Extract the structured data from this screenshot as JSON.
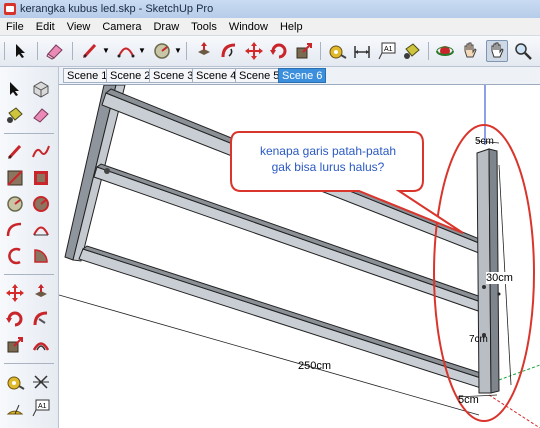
{
  "window": {
    "title": "kerangka kubus led.skp - SketchUp Pro"
  },
  "menu": {
    "items": [
      "File",
      "Edit",
      "View",
      "Camera",
      "Draw",
      "Tools",
      "Window",
      "Help"
    ]
  },
  "toolbar": {
    "icons": [
      "select-arrow-icon",
      "eraser-icon",
      "pencil-line-icon",
      "arc-icon",
      "circle-icon",
      "push-pull-icon",
      "follow-me-icon",
      "move-icon",
      "rotate-icon",
      "scale-icon",
      "tape-measure-icon",
      "text-label-icon",
      "paint-bucket-icon",
      "orbit-icon",
      "pan-hand-icon",
      "zoom-icon"
    ]
  },
  "scenes": {
    "tabs": [
      "Scene 1",
      "Scene 2",
      "Scene 3",
      "Scene 4",
      "Scene 5",
      "Scene 6"
    ],
    "selected": "Scene 6"
  },
  "annotation": {
    "line1": "kenapa garis patah-patah",
    "line2": "gak bisa lurus halus?"
  },
  "dimensions": {
    "length": "250cm",
    "height": "30cm",
    "depth": "5cm",
    "top": "5cm",
    "side": "7cm"
  },
  "colors": {
    "bubble_border": "#d9352c",
    "tab_selected": "#3b8fdc",
    "axis_blue": "#1f3fd6",
    "axis_green": "#1aa33a",
    "axis_red": "#d82b2b"
  }
}
